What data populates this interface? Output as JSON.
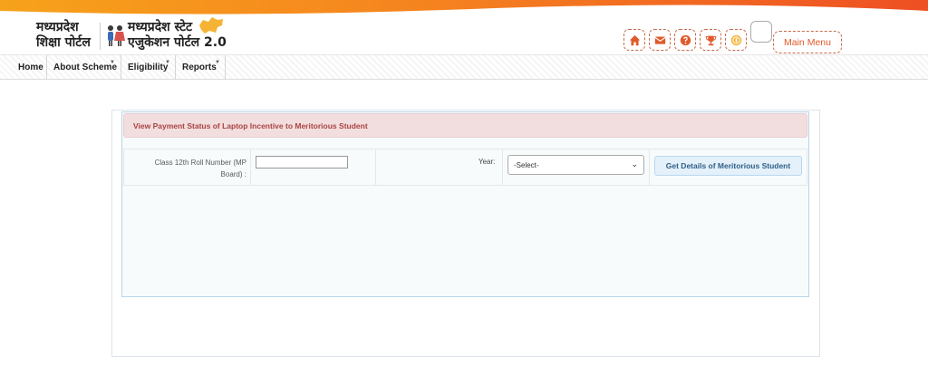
{
  "header": {
    "logo_left_line1": "मध्यप्रदेश",
    "logo_left_line2": "शिक्षा पोर्टल",
    "logo_right_line1": "मध्यप्रदेश स्टेट",
    "logo_right_line2": "एजुकेशन पोर्टल 2.0",
    "main_menu_label": "Main Menu",
    "icons": [
      "home-icon",
      "mail-icon",
      "help-icon",
      "trophy-icon",
      "coin-icon"
    ],
    "icon_color": "#e05a2b"
  },
  "nav": {
    "items": [
      {
        "label": "Home"
      },
      {
        "label": "About Scheme",
        "dropdown": true
      },
      {
        "label": "Eligibility",
        "dropdown": true
      },
      {
        "label": "Reports",
        "dropdown": true
      }
    ]
  },
  "main": {
    "alert_title": "View Payment Status of Laptop Incentive to Meritorious Student",
    "roll_label": "Class 12th Roll Number (MP Board) :",
    "roll_value": "",
    "year_label": "Year:",
    "year_selected": "-Select-",
    "submit_label": "Get Details of Meritorious Student"
  },
  "colors": {
    "accent_orange": "#f26b21",
    "alert_bg": "#f2dede",
    "alert_text": "#a94442",
    "button_bg": "#e4f1fb"
  }
}
